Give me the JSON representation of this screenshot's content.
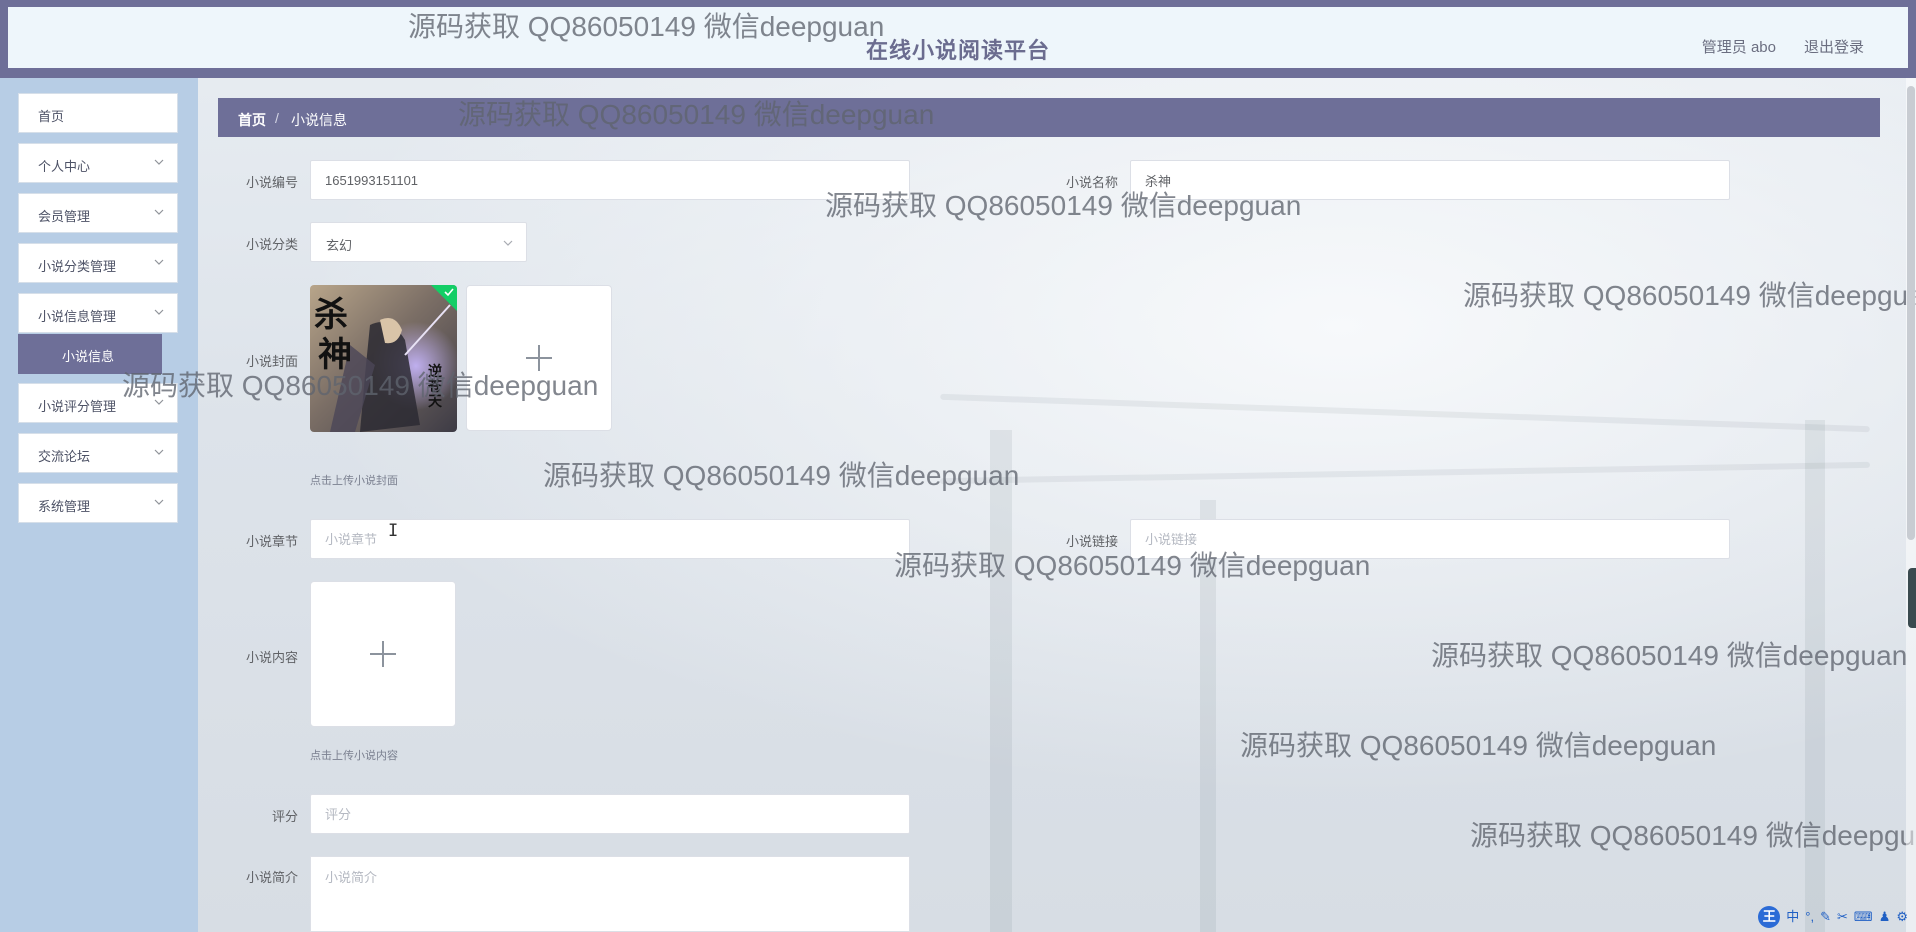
{
  "header": {
    "app_title": "在线小说阅读平台",
    "user_label": "管理员 abo",
    "logout_label": "退出登录"
  },
  "sidebar": {
    "items": [
      {
        "label": "首页",
        "has_children": false
      },
      {
        "label": "个人中心",
        "has_children": true
      },
      {
        "label": "会员管理",
        "has_children": true
      },
      {
        "label": "小说分类管理",
        "has_children": true
      },
      {
        "label": "小说信息管理",
        "has_children": true
      },
      {
        "label": "小说评分管理",
        "has_children": true
      },
      {
        "label": "交流论坛",
        "has_children": true
      },
      {
        "label": "系统管理",
        "has_children": true
      }
    ],
    "active_submenu": "小说信息"
  },
  "breadcrumb": {
    "home": "首页",
    "separator": "/",
    "current": "小说信息"
  },
  "form": {
    "novel_no": {
      "label": "小说编号",
      "value": "1651993151101"
    },
    "novel_name": {
      "label": "小说名称",
      "value": "杀神"
    },
    "category": {
      "label": "小说分类",
      "value": "玄幻"
    },
    "cover": {
      "label": "小说封面",
      "hint": "点击上传小说封面",
      "cover_text_1": "杀",
      "cover_text_2": "神",
      "cover_text_3": "逆苍天"
    },
    "chapter": {
      "label": "小说章节",
      "placeholder": "小说章节"
    },
    "link": {
      "label": "小说链接",
      "placeholder": "小说链接"
    },
    "content": {
      "label": "小说内容",
      "hint": "点击上传小说内容"
    },
    "rating": {
      "label": "评分",
      "placeholder": "评分"
    },
    "intro": {
      "label": "小说简介",
      "placeholder": "小说简介"
    }
  },
  "watermark_text": "源码获取 QQ86050149 微信deepguan",
  "ime": {
    "logo": "王",
    "mode": "中"
  },
  "colors": {
    "primary": "#6e6f98",
    "sidebar_bg": "#b7cde5",
    "header_inner": "#eef6fb",
    "success": "#13ce66"
  },
  "icons": [
    "chevron-down-icon",
    "plus-icon",
    "check-icon",
    "ibeam-cursor-icon"
  ]
}
